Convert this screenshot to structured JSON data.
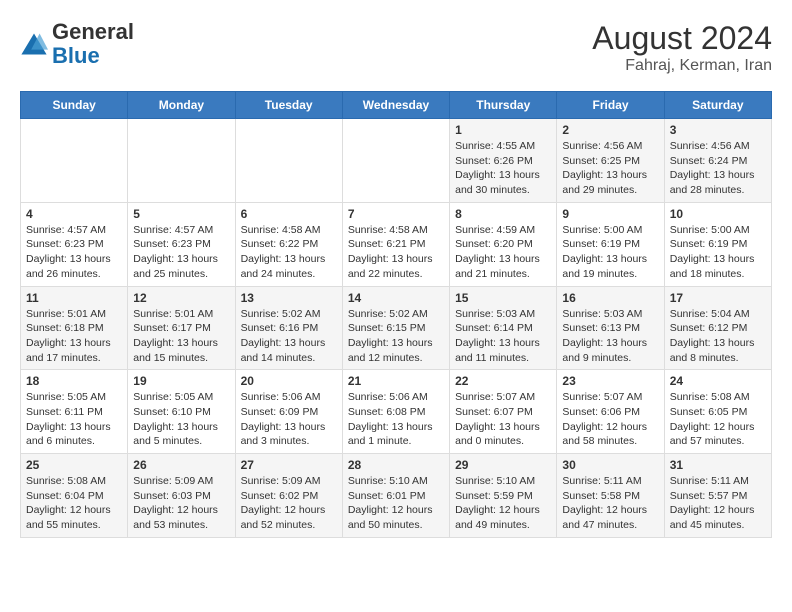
{
  "header": {
    "logo_general": "General",
    "logo_blue": "Blue",
    "month_year": "August 2024",
    "location": "Fahraj, Kerman, Iran"
  },
  "days_of_week": [
    "Sunday",
    "Monday",
    "Tuesday",
    "Wednesday",
    "Thursday",
    "Friday",
    "Saturday"
  ],
  "weeks": [
    [
      {
        "day": "",
        "info": ""
      },
      {
        "day": "",
        "info": ""
      },
      {
        "day": "",
        "info": ""
      },
      {
        "day": "",
        "info": ""
      },
      {
        "day": "1",
        "info": "Sunrise: 4:55 AM\nSunset: 6:26 PM\nDaylight: 13 hours\nand 30 minutes."
      },
      {
        "day": "2",
        "info": "Sunrise: 4:56 AM\nSunset: 6:25 PM\nDaylight: 13 hours\nand 29 minutes."
      },
      {
        "day": "3",
        "info": "Sunrise: 4:56 AM\nSunset: 6:24 PM\nDaylight: 13 hours\nand 28 minutes."
      }
    ],
    [
      {
        "day": "4",
        "info": "Sunrise: 4:57 AM\nSunset: 6:23 PM\nDaylight: 13 hours\nand 26 minutes."
      },
      {
        "day": "5",
        "info": "Sunrise: 4:57 AM\nSunset: 6:23 PM\nDaylight: 13 hours\nand 25 minutes."
      },
      {
        "day": "6",
        "info": "Sunrise: 4:58 AM\nSunset: 6:22 PM\nDaylight: 13 hours\nand 24 minutes."
      },
      {
        "day": "7",
        "info": "Sunrise: 4:58 AM\nSunset: 6:21 PM\nDaylight: 13 hours\nand 22 minutes."
      },
      {
        "day": "8",
        "info": "Sunrise: 4:59 AM\nSunset: 6:20 PM\nDaylight: 13 hours\nand 21 minutes."
      },
      {
        "day": "9",
        "info": "Sunrise: 5:00 AM\nSunset: 6:19 PM\nDaylight: 13 hours\nand 19 minutes."
      },
      {
        "day": "10",
        "info": "Sunrise: 5:00 AM\nSunset: 6:19 PM\nDaylight: 13 hours\nand 18 minutes."
      }
    ],
    [
      {
        "day": "11",
        "info": "Sunrise: 5:01 AM\nSunset: 6:18 PM\nDaylight: 13 hours\nand 17 minutes."
      },
      {
        "day": "12",
        "info": "Sunrise: 5:01 AM\nSunset: 6:17 PM\nDaylight: 13 hours\nand 15 minutes."
      },
      {
        "day": "13",
        "info": "Sunrise: 5:02 AM\nSunset: 6:16 PM\nDaylight: 13 hours\nand 14 minutes."
      },
      {
        "day": "14",
        "info": "Sunrise: 5:02 AM\nSunset: 6:15 PM\nDaylight: 13 hours\nand 12 minutes."
      },
      {
        "day": "15",
        "info": "Sunrise: 5:03 AM\nSunset: 6:14 PM\nDaylight: 13 hours\nand 11 minutes."
      },
      {
        "day": "16",
        "info": "Sunrise: 5:03 AM\nSunset: 6:13 PM\nDaylight: 13 hours\nand 9 minutes."
      },
      {
        "day": "17",
        "info": "Sunrise: 5:04 AM\nSunset: 6:12 PM\nDaylight: 13 hours\nand 8 minutes."
      }
    ],
    [
      {
        "day": "18",
        "info": "Sunrise: 5:05 AM\nSunset: 6:11 PM\nDaylight: 13 hours\nand 6 minutes."
      },
      {
        "day": "19",
        "info": "Sunrise: 5:05 AM\nSunset: 6:10 PM\nDaylight: 13 hours\nand 5 minutes."
      },
      {
        "day": "20",
        "info": "Sunrise: 5:06 AM\nSunset: 6:09 PM\nDaylight: 13 hours\nand 3 minutes."
      },
      {
        "day": "21",
        "info": "Sunrise: 5:06 AM\nSunset: 6:08 PM\nDaylight: 13 hours\nand 1 minute."
      },
      {
        "day": "22",
        "info": "Sunrise: 5:07 AM\nSunset: 6:07 PM\nDaylight: 13 hours\nand 0 minutes."
      },
      {
        "day": "23",
        "info": "Sunrise: 5:07 AM\nSunset: 6:06 PM\nDaylight: 12 hours\nand 58 minutes."
      },
      {
        "day": "24",
        "info": "Sunrise: 5:08 AM\nSunset: 6:05 PM\nDaylight: 12 hours\nand 57 minutes."
      }
    ],
    [
      {
        "day": "25",
        "info": "Sunrise: 5:08 AM\nSunset: 6:04 PM\nDaylight: 12 hours\nand 55 minutes."
      },
      {
        "day": "26",
        "info": "Sunrise: 5:09 AM\nSunset: 6:03 PM\nDaylight: 12 hours\nand 53 minutes."
      },
      {
        "day": "27",
        "info": "Sunrise: 5:09 AM\nSunset: 6:02 PM\nDaylight: 12 hours\nand 52 minutes."
      },
      {
        "day": "28",
        "info": "Sunrise: 5:10 AM\nSunset: 6:01 PM\nDaylight: 12 hours\nand 50 minutes."
      },
      {
        "day": "29",
        "info": "Sunrise: 5:10 AM\nSunset: 5:59 PM\nDaylight: 12 hours\nand 49 minutes."
      },
      {
        "day": "30",
        "info": "Sunrise: 5:11 AM\nSunset: 5:58 PM\nDaylight: 12 hours\nand 47 minutes."
      },
      {
        "day": "31",
        "info": "Sunrise: 5:11 AM\nSunset: 5:57 PM\nDaylight: 12 hours\nand 45 minutes."
      }
    ]
  ]
}
